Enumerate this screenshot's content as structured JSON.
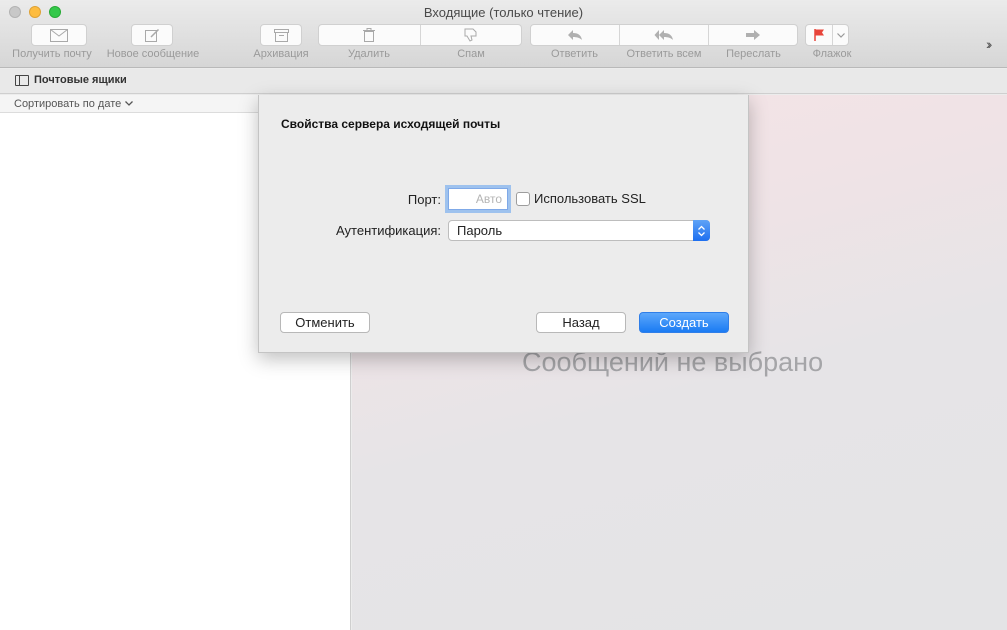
{
  "window": {
    "title": "Входящие (только чтение)"
  },
  "toolbar": {
    "get_mail": "Получить почту",
    "new_message": "Новое сообщение",
    "archive": "Архивация",
    "delete": "Удалить",
    "spam": "Спам",
    "reply": "Ответить",
    "reply_all": "Ответить всем",
    "forward": "Переслать",
    "flag": "Флажок",
    "flag_color": "#e8443a"
  },
  "mailboxes_bar": {
    "label": "Почтовые ящики"
  },
  "message_list": {
    "sort_label": "Сортировать по дате"
  },
  "reader": {
    "empty_text": "Сообщений не выбрано"
  },
  "dialog": {
    "title": "Свойства сервера исходящей почты",
    "port_label": "Порт:",
    "port_placeholder": "Авто",
    "port_value": "",
    "ssl_label": "Использовать SSL",
    "ssl_checked": false,
    "auth_label": "Аутентификация:",
    "auth_value": "Пароль",
    "cancel_button": "Отменить",
    "back_button": "Назад",
    "create_button": "Создать",
    "accent_color": "#1a7bf3"
  }
}
